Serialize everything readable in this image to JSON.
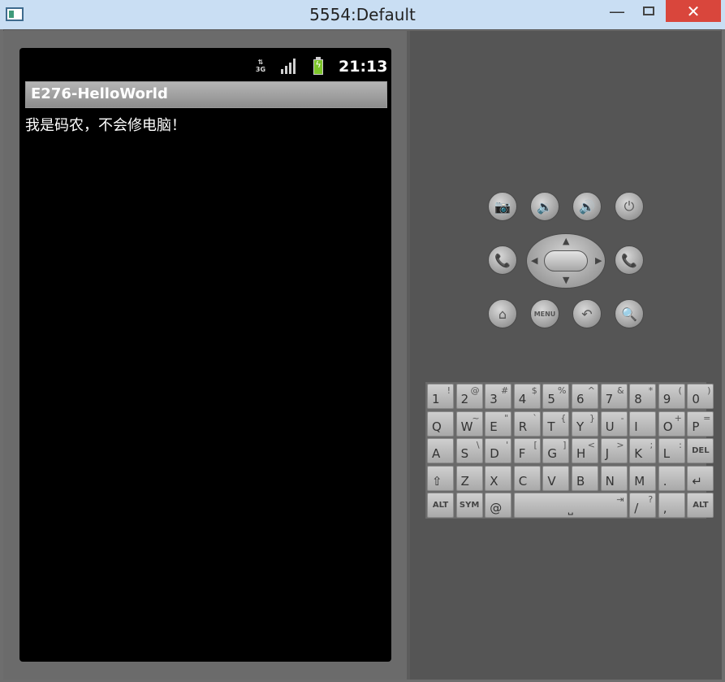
{
  "window": {
    "title": "5554:Default",
    "minimize": "—",
    "close": "✕"
  },
  "status_bar": {
    "network": "3G",
    "time": "21:13"
  },
  "app": {
    "title": "E276-HelloWorld",
    "message": "我是码农，不会修电脑！"
  },
  "hardware_buttons": {
    "camera": "📷",
    "volume_down": "🔉",
    "volume_up": "🔊",
    "power": "⏻",
    "call": "📞",
    "end_call": "📞",
    "home": "⌂",
    "menu": "MENU",
    "back": "↶",
    "search": "🔍"
  },
  "keyboard": {
    "row1": [
      [
        "1",
        "!"
      ],
      [
        "2",
        "@"
      ],
      [
        "3",
        "#"
      ],
      [
        "4",
        "$"
      ],
      [
        "5",
        "%"
      ],
      [
        "6",
        "^"
      ],
      [
        "7",
        "&"
      ],
      [
        "8",
        "*"
      ],
      [
        "9",
        "("
      ],
      [
        "0",
        ")"
      ]
    ],
    "row2": [
      [
        "Q",
        ""
      ],
      [
        "W",
        "~"
      ],
      [
        "E",
        "\""
      ],
      [
        "R",
        "`"
      ],
      [
        "T",
        "{"
      ],
      [
        "Y",
        "}"
      ],
      [
        "U",
        "-"
      ],
      [
        "I",
        ""
      ],
      [
        "O",
        "+"
      ],
      [
        "P",
        "="
      ]
    ],
    "row3": [
      [
        "A",
        ""
      ],
      [
        "S",
        "\\"
      ],
      [
        "D",
        "'"
      ],
      [
        "F",
        "["
      ],
      [
        "G",
        "]"
      ],
      [
        "H",
        "<"
      ],
      [
        "J",
        ">"
      ],
      [
        "K",
        ";"
      ],
      [
        "L",
        ":"
      ]
    ],
    "row4": [
      [
        "Z",
        ""
      ],
      [
        "X",
        ""
      ],
      [
        "C",
        ""
      ],
      [
        "V",
        ""
      ],
      [
        "B",
        ""
      ],
      [
        "N",
        ""
      ],
      [
        "M",
        ""
      ],
      [
        ".",
        ""
      ]
    ],
    "del": "DEL",
    "alt_left": "ALT",
    "sym": "SYM",
    "at": "@",
    "slash": "/",
    "question": "?",
    "comma": ",",
    "alt_right": "ALT",
    "shift": "⇧",
    "enter": "↵",
    "tab": "⇥",
    "space": "⎵"
  }
}
